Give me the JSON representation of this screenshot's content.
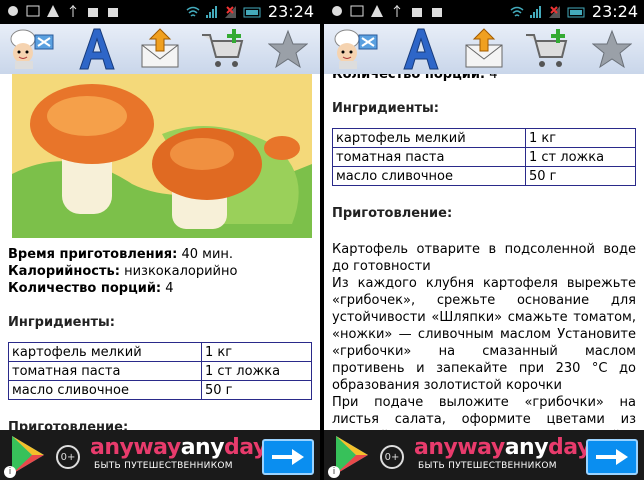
{
  "status_bar": {
    "time": "23:24"
  },
  "recipe": {
    "prep_label": "Время приготовления:",
    "prep_value": "40 мин.",
    "cal_label": "Калорийность:",
    "cal_value": "низкокалорийно",
    "portions_label": "Количество порций:",
    "portions_value": "4",
    "ingredients_heading": "Ингридиенты:",
    "ingredients": [
      {
        "name": "картофель мелкий",
        "qty": "1 кг"
      },
      {
        "name": "томатная паста",
        "qty": "1 ст ложка"
      },
      {
        "name": "масло сливочное",
        "qty": "50 г"
      }
    ],
    "steps_heading": "Приготовление:",
    "steps": [
      "Картофель отварите в подсоленной воде до готовности",
      "Из каждого клубня картофеля вырежьте «грибочек», срежьте основание для устойчивости «Шляпки» смажьте томатом, «ножки» — сливочным маслом Установите «грибочки» на смазанный маслом противень и запекайте при 230 °С до образования золотистой корочки",
      "При подаче выложите «грибочки» на листья салата, оформите цветами из вареной моркови Отдельно подайте сметану"
    ]
  },
  "ad": {
    "brand_part1": "anyway",
    "brand_part2": "any",
    "brand_part3": "day",
    "tagline": "БЫТЬ ПУТЕШЕСТВЕННИКОМ",
    "zero_badge": "0+"
  },
  "colors": {
    "ad_accent": "#e83b6c",
    "go_button": "#0a8ef0",
    "table_border": "#2a2a8a"
  }
}
